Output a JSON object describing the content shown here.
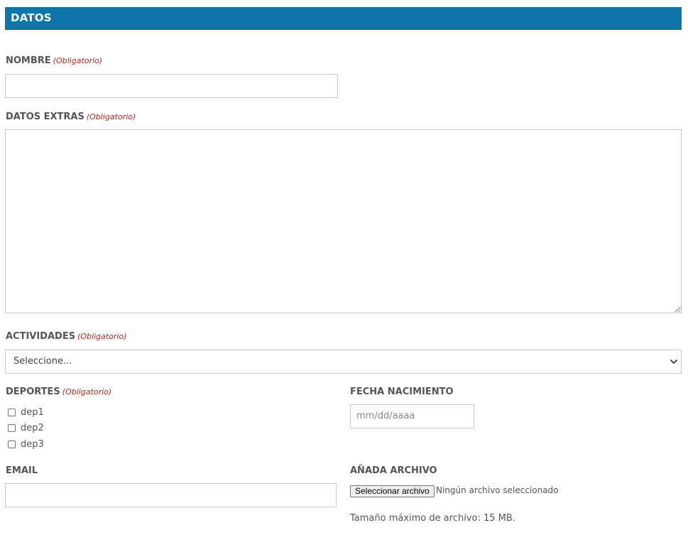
{
  "section": {
    "title": "DATOS"
  },
  "required_tag": "(Obligatorio)",
  "fields": {
    "nombre": {
      "label": "NOMBRE",
      "value": ""
    },
    "datos_extras": {
      "label": "DATOS EXTRAS",
      "value": ""
    },
    "actividades": {
      "label": "ACTIVIDADES",
      "selected": "Seleccione..."
    },
    "deportes": {
      "label": "DEPORTES",
      "options": [
        {
          "label": "dep1",
          "checked": false
        },
        {
          "label": "dep2",
          "checked": false
        },
        {
          "label": "dep3",
          "checked": false
        }
      ]
    },
    "fecha_nacimiento": {
      "label": "FECHA NACIMIENTO",
      "placeholder": "mm/dd/aaaa"
    },
    "email": {
      "label": "EMAIL",
      "value": ""
    },
    "archivo": {
      "label": "AÑADA ARCHIVO",
      "button_label": "Seleccionar archivo",
      "status": "Ningún archivo seleccionado",
      "note": "Tamaño máximo de archivo: 15 MB."
    }
  },
  "colors": {
    "header": "#0f74a7",
    "required": "#b0281a"
  }
}
